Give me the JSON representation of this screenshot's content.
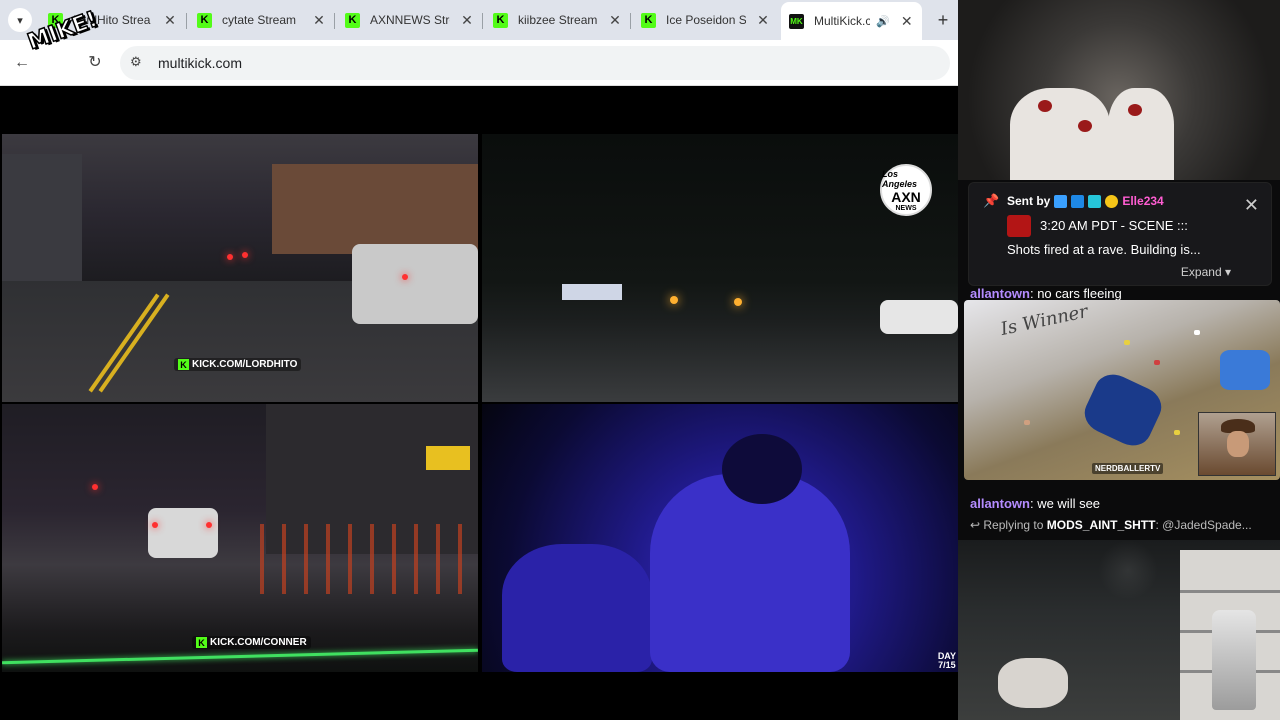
{
  "browser": {
    "tabs": [
      {
        "title": "LordHito Strea",
        "favicon": "kick-icon"
      },
      {
        "title": "cytate Stream",
        "favicon": "kick-icon"
      },
      {
        "title": "AXNNEWS Stre",
        "favicon": "kick-icon"
      },
      {
        "title": "kiibzee Stream",
        "favicon": "kick-icon"
      },
      {
        "title": "Ice Poseidon S",
        "favicon": "kick-icon"
      },
      {
        "title": "MultiKick.c",
        "favicon": "multikick-icon",
        "active": true,
        "audible": true
      }
    ],
    "address": "multikick.com",
    "overlay_sticker": "MIKE!"
  },
  "streams": [
    {
      "id": "lordhito",
      "watermark": "KICK.COM/LORDHITO"
    },
    {
      "id": "axnnews",
      "logo_top": "Los Angeles",
      "logo_main": "AXN",
      "logo_bottom": "NEWS"
    },
    {
      "id": "conner",
      "watermark": "KICK.COM/CONNER"
    },
    {
      "id": "ice",
      "day_label": "DAY",
      "day_value": "7/15"
    }
  ],
  "side_panel": {
    "pinned": {
      "sent_by_label": "Sent by",
      "user": "Elle234",
      "line1": "3:20 AM PDT - SCENE :::",
      "line2": "Shots fired at a rave. Building is...",
      "expand_label": "Expand"
    },
    "chat": [
      {
        "user": "allantown",
        "message": "no cars fleeing"
      },
      {
        "user": "allantown",
        "message": "we will see",
        "reply_label": "Replying to",
        "reply_user": "MODS_AINT_SHTT",
        "reply_text": "@JadedSpade..."
      }
    ],
    "cam2_label": "NERDBALLERTV",
    "cam2_wall_text": "Is Winner"
  },
  "colors": {
    "kick_green": "#53fc18",
    "chat_user": "#b48cff",
    "pin_user": "#ff5dd2"
  }
}
